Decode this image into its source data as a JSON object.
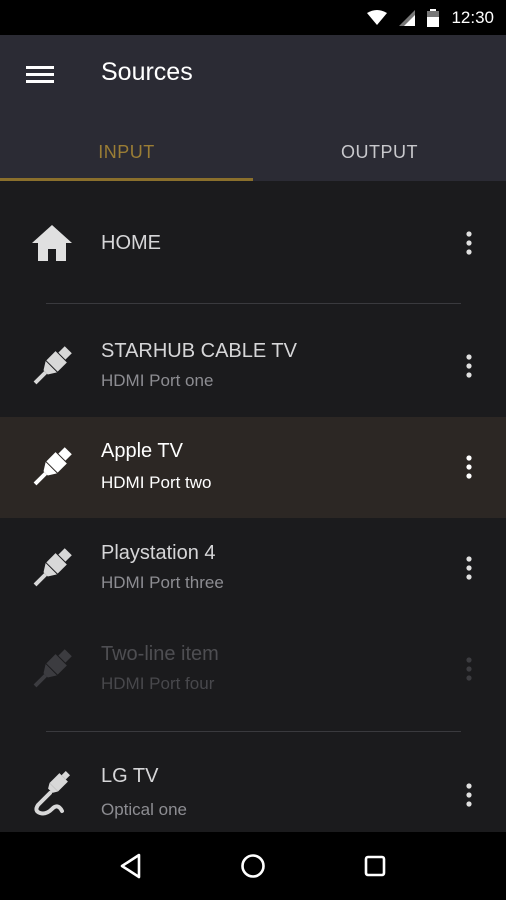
{
  "status_bar": {
    "time": "12:30"
  },
  "app_bar": {
    "title": "Sources"
  },
  "tabs": [
    {
      "label": "INPUT",
      "active": true
    },
    {
      "label": "OUTPUT",
      "active": false
    }
  ],
  "sources": [
    {
      "primary": "HOME",
      "icon": "home-icon"
    },
    {
      "primary": "STARHUB CABLE TV",
      "secondary": "HDMI Port one",
      "icon": "hdmi-cable-icon"
    },
    {
      "primary": "Apple TV",
      "secondary": "HDMI Port two",
      "icon": "hdmi-cable-icon",
      "selected": true
    },
    {
      "primary": "Playstation 4",
      "secondary": "HDMI Port three",
      "icon": "hdmi-cable-icon"
    },
    {
      "primary": "Two-line item",
      "secondary": "HDMI Port four",
      "icon": "hdmi-cable-icon",
      "disabled": true
    },
    {
      "primary": "LG TV",
      "secondary": "Optical one",
      "icon": "optical-cable-icon"
    }
  ],
  "colors": {
    "accent": "#9a7d35",
    "app_bar": "#2b2b34",
    "background": "#1b1b1d",
    "selected_row": "#2c2724"
  }
}
